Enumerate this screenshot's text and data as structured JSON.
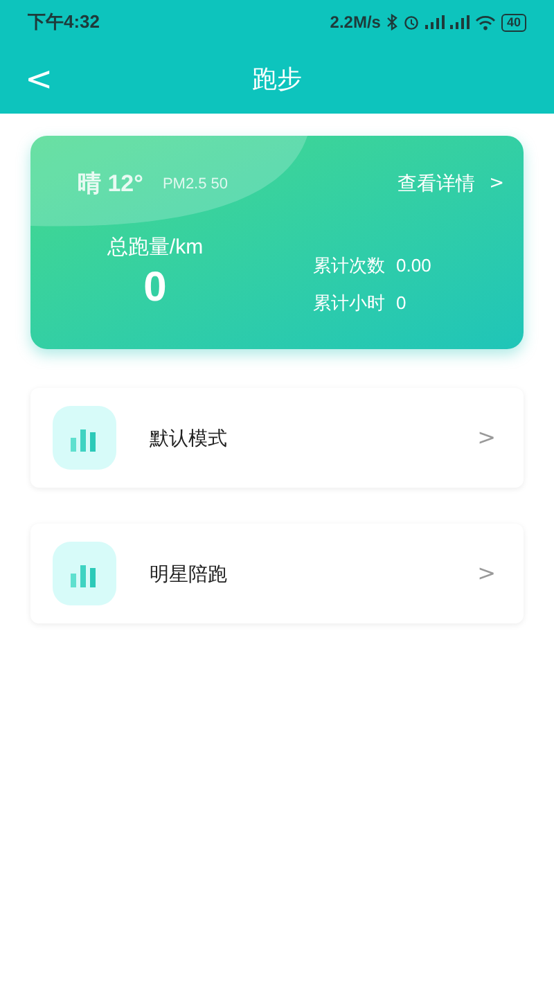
{
  "status_bar": {
    "time": "下午4:32",
    "speed": "2.2M/s",
    "battery": "40"
  },
  "header": {
    "back": "<",
    "title": "跑步"
  },
  "summary": {
    "weather": "晴 12°",
    "pm25": "PM2.5 50",
    "details_link": "查看详情",
    "details_arrow": ">",
    "total_label": "总跑量/km",
    "total_value": "0",
    "stats": [
      {
        "label": "累计次数",
        "value": "0.00"
      },
      {
        "label": "累计小时",
        "value": "0"
      }
    ]
  },
  "modes": [
    {
      "label": "默认模式",
      "arrow": ">"
    },
    {
      "label": "明星陪跑",
      "arrow": ">"
    }
  ]
}
